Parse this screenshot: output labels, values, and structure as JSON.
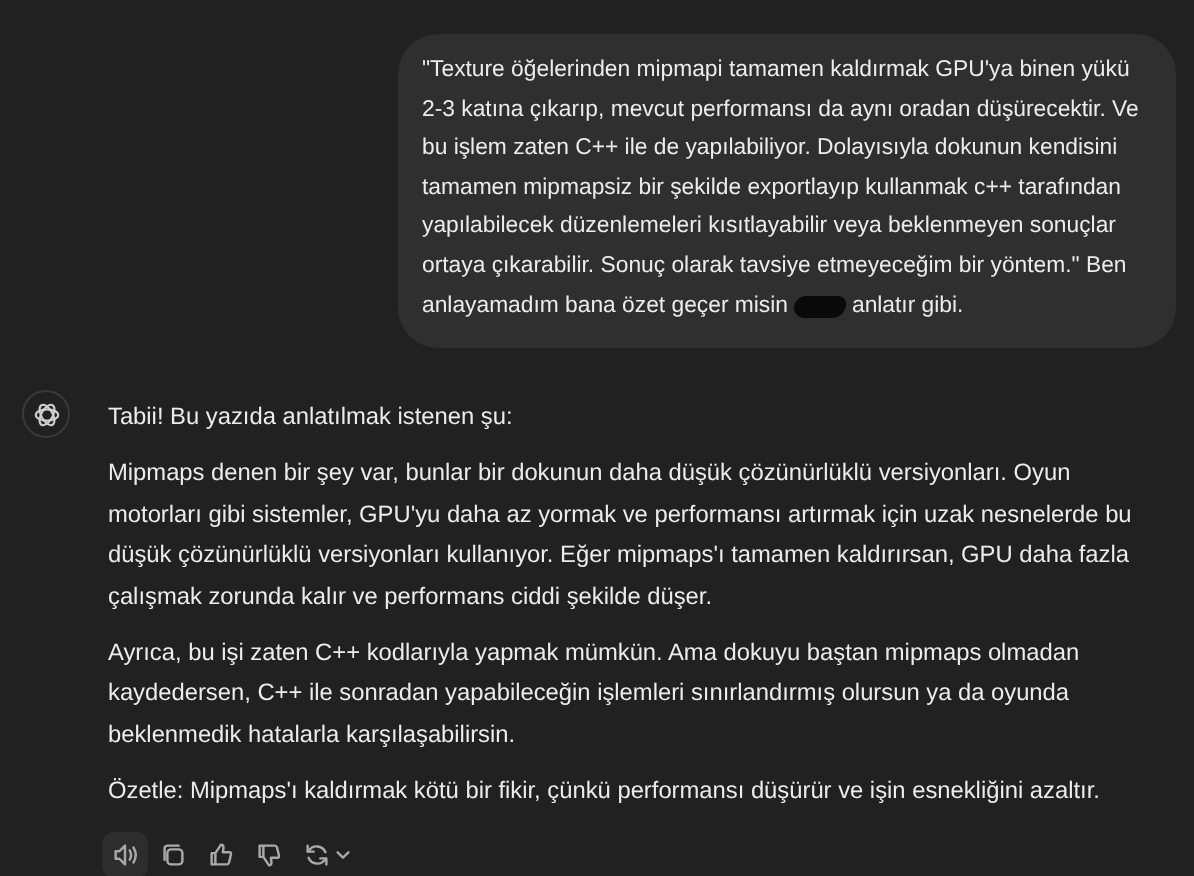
{
  "user_message": {
    "text": "\"Texture öğelerinden mipmapi tamamen kaldırmak GPU'ya binen yükü 2-3 katına çıkarıp, mevcut performansı da aynı oradan düşürecektir. Ve bu işlem zaten C++ ile de yapılabiliyor. Dolayısıyla dokunun kendisini tamamen mipmapsiz bir şekilde exportlayıp kullanmak c++ tarafından yapılabilecek düzenlemeleri kısıtlayabilir veya beklenmeyen sonuçlar ortaya çıkarabilir. Sonuç olarak tavsiye etmeyeceğim bir yöntem.\" Ben",
    "text_before": "anlayamadım bana özet geçer misin",
    "redacted": true,
    "text_after": "anlatır gibi."
  },
  "assistant_message": {
    "paragraphs": [
      "Tabii! Bu yazıda anlatılmak istenen şu:",
      "Mipmaps denen bir şey var, bunlar bir dokunun daha düşük çözünürlüklü versiyonları. Oyun motorları gibi sistemler, GPU'yu daha az yormak ve performansı artırmak için uzak nesnelerde bu düşük çözünürlüklü versiyonları kullanıyor. Eğer mipmaps'ı tamamen kaldırırsan, GPU daha fazla çalışmak zorunda kalır ve performans ciddi şekilde düşer.",
      "Ayrıca, bu işi zaten C++ kodlarıyla yapmak mümkün. Ama dokuyu baştan mipmaps olmadan kaydedersen, C++ ile sonradan yapabileceğin işlemleri sınırlandırmış olursun ya da oyunda beklenmedik hatalarla karşılaşabilirsin.",
      "Özetle: Mipmaps'ı kaldırmak kötü bir fikir, çünkü performansı düşürür ve işin esnekliğini azaltır."
    ],
    "actions": [
      {
        "kind": "speaker",
        "highlighted": true
      },
      {
        "kind": "copy",
        "highlighted": false
      },
      {
        "kind": "thumbs-up",
        "highlighted": false
      },
      {
        "kind": "thumbs-down",
        "highlighted": false
      },
      {
        "kind": "regenerate",
        "highlighted": false
      }
    ]
  }
}
